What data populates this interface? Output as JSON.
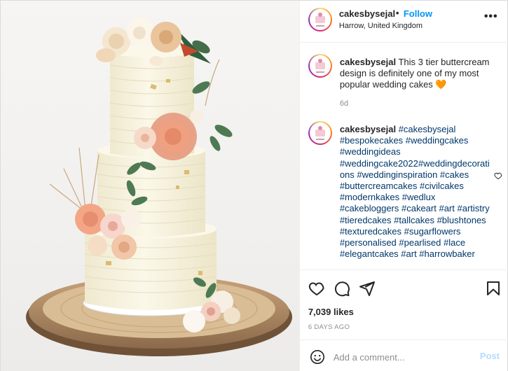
{
  "account": {
    "username": "cakesbysejal",
    "dot": "•",
    "follow_label": "Follow",
    "location": "Harrow, United Kingdom",
    "more_icon": "more-options-icon"
  },
  "caption": {
    "username": "cakesbysejal",
    "text": "This 3 tier buttercream design is definitely one of my most popular wedding cakes 🧡",
    "time": "6d"
  },
  "comment": {
    "username": "cakesbysejal",
    "text": "#cakesbysejal #bespokecakes #weddingcakes #weddingideas #weddingcake2022#weddingdecorations #weddinginspiration #cakes #buttercreamcakes #civilcakes #modernkakes #wedlux #cakebloggers #cakeart #art #artistry #tieredcakes #tallcakes #blushtones #texturedcakes #sugarflowers #personalised #pearlised #lace #elegantcakes #art #harrowbaker"
  },
  "actions": {
    "like_icon": "heart-icon",
    "comment_icon": "comment-icon",
    "share_icon": "share-icon",
    "save_icon": "bookmark-icon",
    "likes": "7,039 likes",
    "ago": "6 DAYS AGO"
  },
  "add_comment": {
    "placeholder": "Add a comment...",
    "post_label": "Post",
    "emoji_icon": "emoji-icon"
  },
  "colors": {
    "link": "#0095f6",
    "hashtag": "#00376b",
    "muted": "#8e8e8e",
    "post_disabled": "#b3dbff"
  }
}
